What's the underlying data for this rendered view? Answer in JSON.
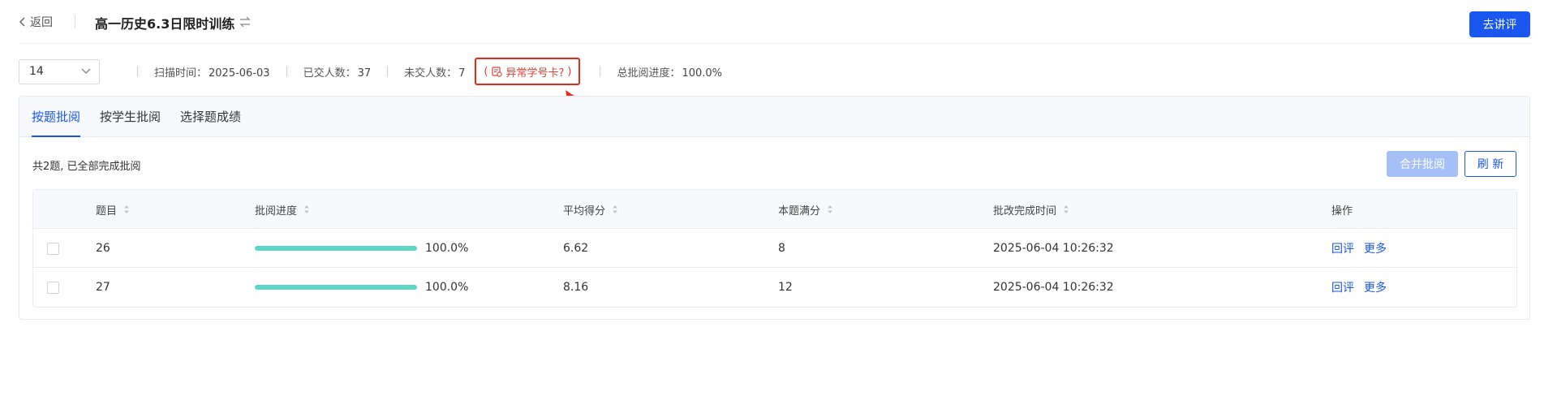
{
  "header": {
    "back_label": "返回",
    "title": "高一历史6.3日限时训练",
    "primary_button": "去讲评"
  },
  "info": {
    "select_value": "14",
    "scan_time_label": "扫描时间：",
    "scan_time_value": "2025-06-03",
    "submitted_label": "已交人数：",
    "submitted_value": "37",
    "not_submitted_label": "未交人数：",
    "not_submitted_value": "7",
    "abnormal_open": "(",
    "abnormal_label": "异常学号卡?",
    "abnormal_close": ")",
    "total_progress_label": "总批阅进度：",
    "total_progress_value": "100.0%"
  },
  "tabs": [
    {
      "label": "按题批阅",
      "active": true
    },
    {
      "label": "按学生批阅",
      "active": false
    },
    {
      "label": "选择题成绩",
      "active": false
    }
  ],
  "summary": "共2题, 已全部完成批阅",
  "buttons": {
    "merge": "合并批阅",
    "refresh": "刷 新"
  },
  "table": {
    "headers": {
      "title": "题目",
      "progress": "批阅进度",
      "avg": "平均得分",
      "full": "本题满分",
      "time": "批改完成时间",
      "op": "操作"
    },
    "rows": [
      {
        "title": "26",
        "progress": 1.0,
        "progress_text": "100.0%",
        "avg": "6.62",
        "full": "8",
        "time": "2025-06-04 10:26:32",
        "op1": "回评",
        "op2": "更多"
      },
      {
        "title": "27",
        "progress": 1.0,
        "progress_text": "100.0%",
        "avg": "8.16",
        "full": "12",
        "time": "2025-06-04 10:26:32",
        "op1": "回评",
        "op2": "更多"
      }
    ]
  },
  "colors": {
    "primary": "#1a56f0",
    "progress_fill": "#5cd6c6",
    "alert": "#e0403a",
    "annotation": "#e52a1a"
  },
  "icons": {
    "back": "chevron-left-icon",
    "swap": "swap-icon",
    "dropdown": "chevron-down-icon",
    "abnormal": "id-card-icon",
    "sort": "sort-icon"
  }
}
